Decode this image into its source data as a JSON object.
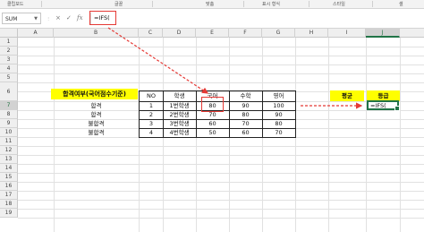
{
  "ribbon": {
    "groups": [
      "클립보드",
      "글꼴",
      "맞춤",
      "표시 형식",
      "스타일",
      "셀"
    ]
  },
  "formula_bar": {
    "name_box": "SUM",
    "cancel_icon": "×",
    "enter_icon": "✓",
    "fx_label": "fx",
    "formula": "=IFS("
  },
  "columns": [
    "A",
    "B",
    "C",
    "D",
    "E",
    "F",
    "G",
    "H",
    "I",
    "J"
  ],
  "rows": [
    "1",
    "2",
    "3",
    "4",
    "5",
    "6",
    "7",
    "8",
    "9",
    "10",
    "11",
    "12",
    "13",
    "14",
    "15",
    "16",
    "17",
    "18",
    "19"
  ],
  "sheet": {
    "b6_title": "합격여부(국어점수기준)",
    "results": [
      "합격",
      "합격",
      "불합격",
      "불합격"
    ],
    "table_headers": [
      "NO",
      "학생",
      "국어",
      "수학",
      "영어"
    ],
    "table_rows": [
      [
        "1",
        "1번학생",
        "80",
        "90",
        "100"
      ],
      [
        "2",
        "2번학생",
        "70",
        "80",
        "90"
      ],
      [
        "3",
        "3번학생",
        "60",
        "70",
        "80"
      ],
      [
        "4",
        "4번학생",
        "50",
        "60",
        "70"
      ]
    ],
    "avg_label": "평균",
    "grade_label": "등급",
    "active_cell_text": "=IFS("
  },
  "colors": {
    "highlight_yellow": "#ffff00",
    "annotation_red": "#e53935",
    "excel_green": "#217346"
  }
}
